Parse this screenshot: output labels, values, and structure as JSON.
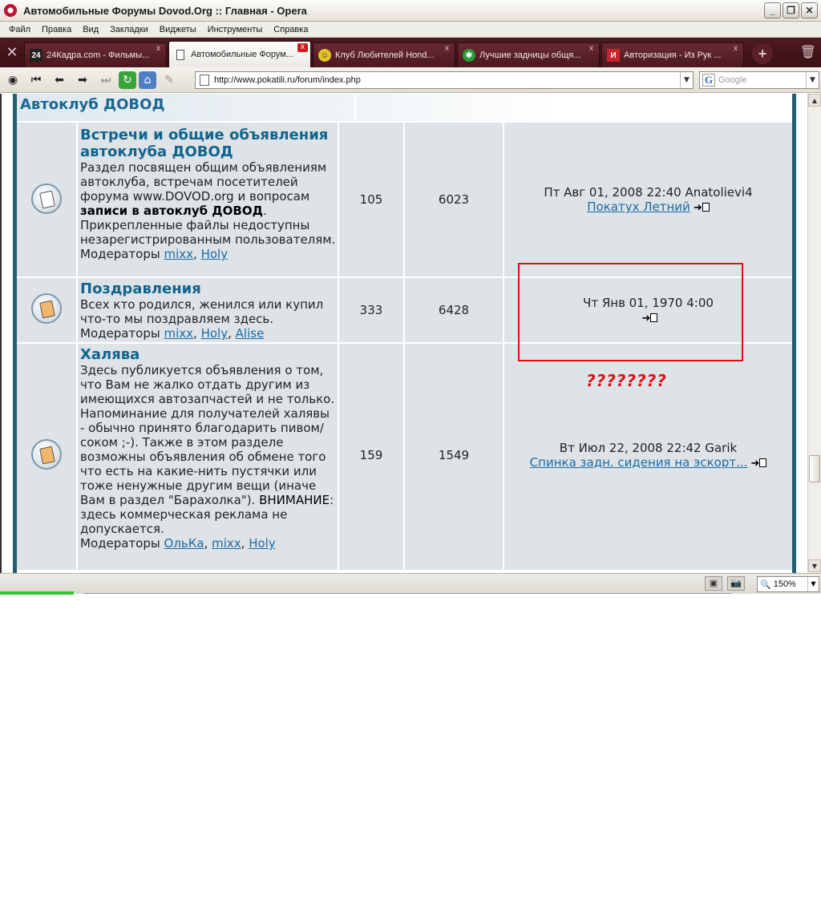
{
  "window": {
    "title": "Автомобильные Форумы Dovod.Org :: Главная - Opera",
    "buttons": {
      "minimize": "_",
      "maximize": "❐",
      "close": "✕"
    }
  },
  "menu": [
    "Файл",
    "Правка",
    "Вид",
    "Закладки",
    "Виджеты",
    "Инструменты",
    "Справка"
  ],
  "tabs": [
    {
      "label": "24Кадра.com - Фильмы...",
      "icon_text": "24",
      "active": false
    },
    {
      "label": "Автомобильные Форум...",
      "icon_text": "",
      "active": true
    },
    {
      "label": "Клуб Любителей Hond...",
      "icon_text": "",
      "active": false
    },
    {
      "label": "Лучшие задницы общя...",
      "icon_text": "",
      "active": false
    },
    {
      "label": "Авторизация - Из Рук ...",
      "icon_text": "И",
      "active": false
    }
  ],
  "tab_close": "x",
  "address": {
    "url": "http://www.pokatili.ru/forum/index.php",
    "search_placeholder": "Google",
    "search_logo": "G"
  },
  "category": {
    "title": "Автоклуб ДОВОД"
  },
  "forums": [
    {
      "name": "Встречи и общие объявления автоклуба ДОВОД",
      "desc_before": "Раздел посвящен общим объявлениям автоклуба, встречам посетителей форума www.DOVOD.org и вопросам ",
      "desc_bold": "записи в автоклуб ДОВОД",
      "desc_after": ". Прикрепленные файлы недоступны незарегистрированным пользователям.",
      "mods_label": "Модераторы",
      "mods": [
        "mixx",
        "Holy"
      ],
      "topics": "105",
      "posts": "6023",
      "last_post_date": "Пт Авг 01, 2008 22:40 Anatolievi4",
      "last_post_link": "Покатух Летний"
    },
    {
      "name": "Поздравления",
      "desc": "Всех кто родился, женился или купил что-то мы поздравляем здесь.",
      "mods_label": "Модераторы",
      "mods": [
        "mixx",
        "Holy",
        "Alise"
      ],
      "topics": "333",
      "posts": "6428",
      "last_post_date": "Чт Янв 01, 1970 4:00"
    },
    {
      "name": "Халява",
      "desc_before": "Здесь публикуется объявления о том, что Вам не жалко отдать другим из имеющихся автозапчастей и не только. Напоминание для получателей халявы - обычно принято благодарить пивом/ сокoм ;-). Также в этом разделе возможны объявления об обмене того что есть на какие-нить пустячки или тоже ненужные другим вещи (иначе Вам в раздел \"Барахолка\"). ",
      "desc_bold": "ВНИМАНИЕ",
      "desc_after": ": здесь коммерческая реклама не допускается.",
      "mods_label": "Модераторы",
      "mods": [
        "ОльКа",
        "mixx",
        "Holy"
      ],
      "topics": "159",
      "posts": "1549",
      "last_post_date": "Вт Июл 22, 2008 22:42 Garik",
      "last_post_link": "Спинка задн. сидения на эскорт..."
    }
  ],
  "annotation": {
    "text": "????????",
    "color": "#e01010"
  },
  "status": {
    "zoom": "150%",
    "progress": 0.09
  },
  "colors": {
    "accent": "#11648e",
    "link": "#1a6aa5",
    "row_bg": "#dee3e7",
    "tabbar": "#4e1a21",
    "progress": "#36c437"
  }
}
